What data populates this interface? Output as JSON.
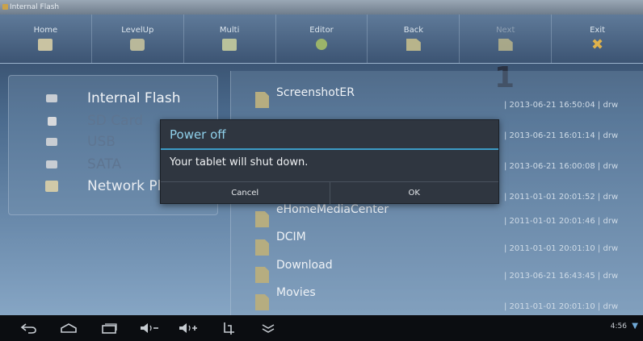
{
  "window": {
    "title": "Internal Flash"
  },
  "toolbar": {
    "buttons": [
      {
        "label": "Home"
      },
      {
        "label": "LevelUp"
      },
      {
        "label": "Multi"
      },
      {
        "label": "Editor"
      },
      {
        "label": "Back"
      },
      {
        "label": "Next"
      },
      {
        "label": "Exit"
      }
    ]
  },
  "page_indicator": "1",
  "locations": [
    {
      "label": "Internal Flash"
    },
    {
      "label": "SD Card"
    },
    {
      "label": "USB"
    },
    {
      "label": "SATA"
    },
    {
      "label": "Network Pl"
    }
  ],
  "files": [
    {
      "name": "ScreenshotER",
      "meta": "| 2013-06-21 16:50:04 | drw"
    },
    {
      "name": "",
      "meta": "| 2013-06-21 16:01:14 | drw"
    },
    {
      "name": "",
      "meta": "| 2013-06-21 16:00:08 | drw"
    },
    {
      "name": "",
      "meta": "| 2011-01-01 20:01:52 | drw"
    },
    {
      "name": "eHomeMediaCenter",
      "meta": "| 2011-01-01 20:01:46 | drw"
    },
    {
      "name": "DCIM",
      "meta": "| 2011-01-01 20:01:10 | drw"
    },
    {
      "name": "Download",
      "meta": "| 2013-06-21 16:43:45 | drw"
    },
    {
      "name": "Movies",
      "meta": "| 2011-01-01 20:01:10 | drw"
    }
  ],
  "dialog": {
    "title": "Power off",
    "message": "Your tablet will shut down.",
    "cancel": "Cancel",
    "ok": "OK"
  },
  "status": {
    "time": "4:56"
  }
}
